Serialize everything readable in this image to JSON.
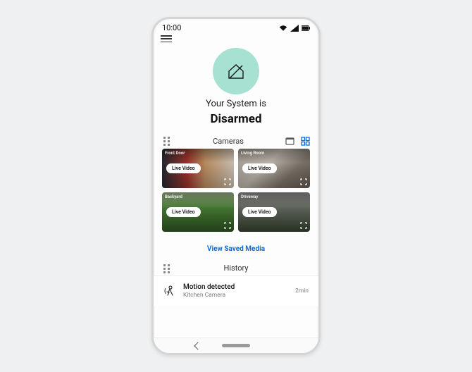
{
  "statusbar": {
    "time": "10:00"
  },
  "system": {
    "line1": "Your System is",
    "status": "Disarmed"
  },
  "cameras": {
    "section_title": "Cameras",
    "live_label": "Live Video",
    "items": [
      {
        "name": "Front Door"
      },
      {
        "name": "Living Room"
      },
      {
        "name": "Backyard"
      },
      {
        "name": "Driveway"
      }
    ],
    "view_saved": "View Saved Media"
  },
  "history": {
    "section_title": "History",
    "items": [
      {
        "title": "Motion detected",
        "subtitle": "Kitchen Camera",
        "time": "2min"
      }
    ]
  },
  "colors": {
    "accent_blue": "#0a6bde",
    "hero_mint": "#a7e1d1"
  }
}
